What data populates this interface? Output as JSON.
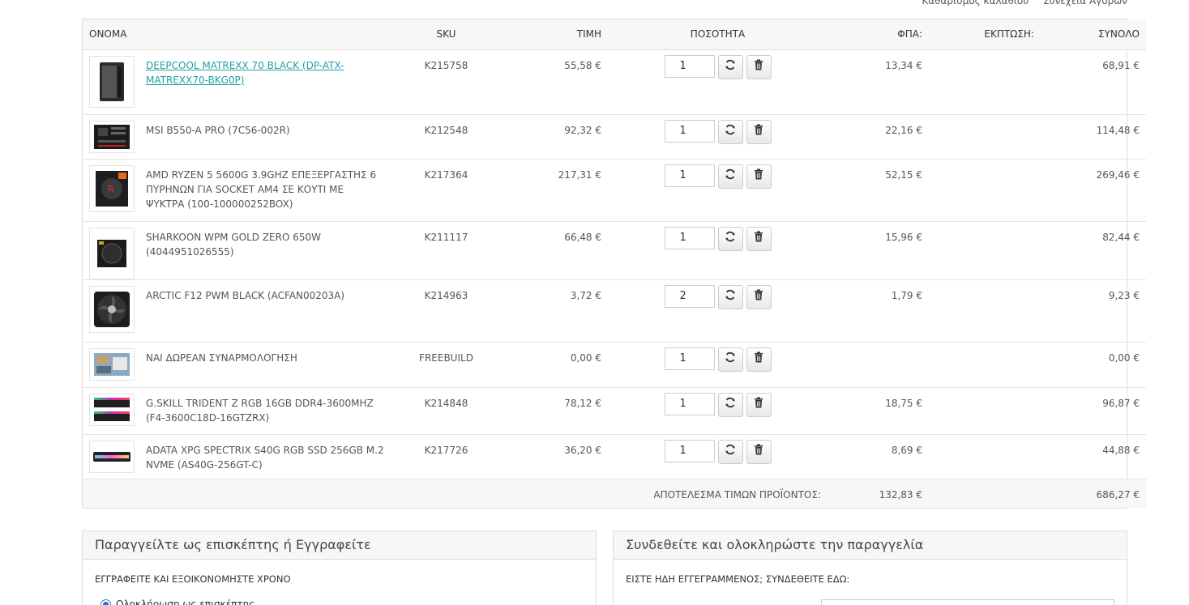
{
  "top_links": {
    "clear_cart": "Καθαρισμός καλαθιού",
    "continue": "Συνέχεια Αγορών"
  },
  "table": {
    "headers": {
      "name": "ΟΝΟΜΑ",
      "sku": "SKU",
      "price": "ΤΙΜΗ",
      "qty": "ΠΟΣΟΤΗΤΑ",
      "vat": "ΦΠΑ:",
      "discount": "ΕΚΠΤΩΣΗ:",
      "total": "ΣΥΝΟΛΟ"
    },
    "rows": [
      {
        "name": "DEEPCOOL MATREXX 70 BLACK (DP-ATX-MATREXX70-BKG0P)",
        "sku": "K215758",
        "price": "55,58 €",
        "qty": "1",
        "vat": "13,34 €",
        "total": "68,91 €",
        "image": "pc-case-icon"
      },
      {
        "name": "MSI B550-A PRO (7C56-002R)",
        "sku": "K212548",
        "price": "92,32 €",
        "qty": "1",
        "vat": "22,16 €",
        "total": "114,48 €",
        "image": "motherboard-icon"
      },
      {
        "name": "AMD RYZEN 5 5600G 3.9GHZ ΕΠΕΞΕΡΓΑΣΤΗΣ 6 ΠΥΡΗΝΩΝ ΓΙΑ SOCKET AM4 ΣΕ ΚΟΥΤΙ ΜΕ ΨΥΚΤΡΑ (100-100000252BOX)",
        "sku": "K217364",
        "price": "217,31 €",
        "qty": "1",
        "vat": "52,15 €",
        "total": "269,46 €",
        "image": "cpu-box-icon"
      },
      {
        "name": "SHARKOON WPM GOLD ZERO 650W (4044951026555)",
        "sku": "K211117",
        "price": "66,48 €",
        "qty": "1",
        "vat": "15,96 €",
        "total": "82,44 €",
        "image": "psu-icon"
      },
      {
        "name": "ARCTIC F12 PWM BLACK (ACFAN00203A)",
        "sku": "K214963",
        "price": "3,72 €",
        "qty": "2",
        "vat": "1,79 €",
        "total": "9,23 €",
        "image": "fan-icon"
      },
      {
        "name": "ΝΑΙ ΔΩΡΕΑΝ ΣΥΝΑΡΜΟΛΟΓΗΣΗ",
        "sku": "FREEBUILD",
        "price": "0,00 €",
        "qty": "1",
        "vat": "",
        "total": "0,00 €",
        "image": "assembly-icon"
      },
      {
        "name": "G.SKILL TRIDENT Z RGB 16GB DDR4-3600MHZ (F4-3600C18D-16GTZRX)",
        "sku": "K214848",
        "price": "78,12 €",
        "qty": "1",
        "vat": "18,75 €",
        "total": "96,87 €",
        "image": "ram-icon"
      },
      {
        "name": "ADATA XPG SPECTRIX S40G RGB SSD 256GB M.2 NVME (AS40G-256GT-C)",
        "sku": "K217726",
        "price": "36,20 €",
        "qty": "1",
        "vat": "8,69 €",
        "total": "44,88 €",
        "image": "ssd-icon"
      }
    ],
    "summary": {
      "label": "ΑΠΟΤΕΛΕΣΜΑ ΤΙΜΩΝ ΠΡΟΪΟΝΤΟΣ:",
      "vat": "132,83 €",
      "total": "686,27 €"
    }
  },
  "guest_panel": {
    "title": "Παραγγείλτε ως επισκέπτης ή Εγγραφείτε",
    "subtitle": "ΕΓΓΡΑΦΕΙΤΕ ΚΑΙ ΕΞΟΙΚΟΝΟΜΗΣΤΕ ΧΡΟΝΟ",
    "option": "Ολοκλήρωση ως επισκέπτης"
  },
  "login_panel": {
    "title": "Συνδεθείτε και ολοκληρώστε την παραγγελία",
    "subtitle": "ΕΙΣΤΕ ΗΔΗ ΕΓΓΕΓΡΑΜΜΕΝΟΣ; ΣΥΝΔΕΘΕΙΤΕ ΕΔΩ:"
  },
  "colors": {
    "link": "#21a0a7",
    "header_bg": "#f7f7f7",
    "border": "#dddddd",
    "radio": "#2a6edb"
  }
}
